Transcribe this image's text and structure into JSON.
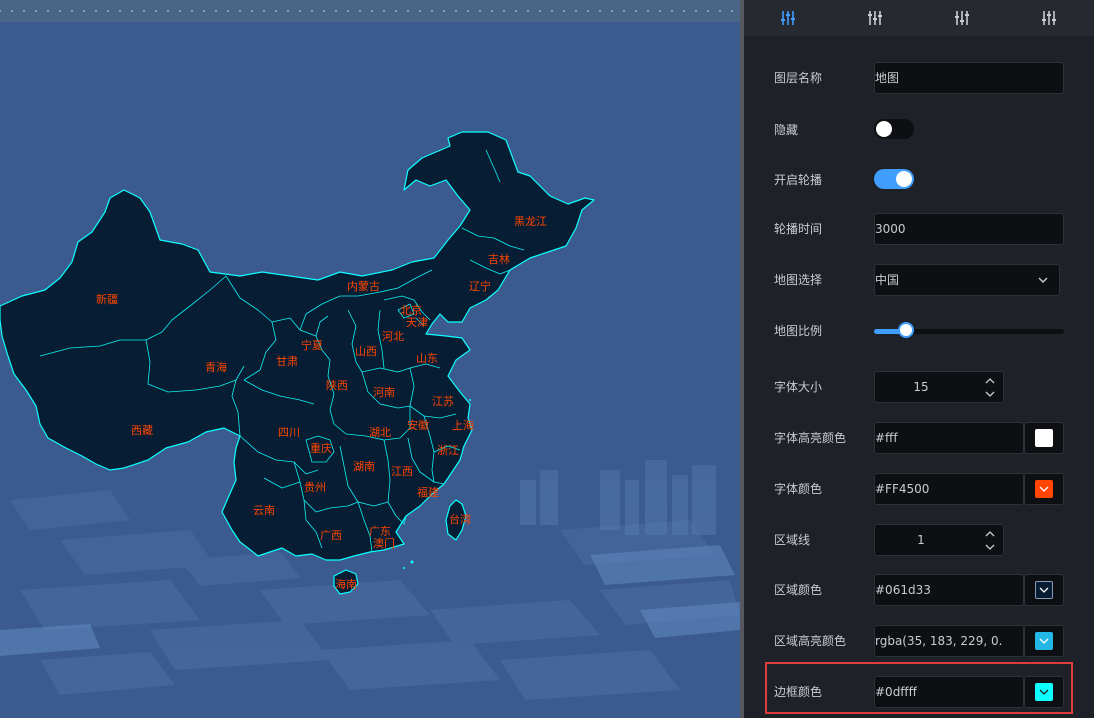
{
  "canvas": {
    "background": "#3b5b8f",
    "map": {
      "region_color": "#061d33",
      "border_color": "#0dffff",
      "label_color": "#FF4500",
      "provinces": [
        {
          "name": "新疆"
        },
        {
          "name": "西藏"
        },
        {
          "name": "青海"
        },
        {
          "name": "甘肃"
        },
        {
          "name": "内蒙古"
        },
        {
          "name": "黑龙江"
        },
        {
          "name": "吉林"
        },
        {
          "name": "辽宁"
        },
        {
          "name": "北京"
        },
        {
          "name": "天津"
        },
        {
          "name": "河北"
        },
        {
          "name": "山西"
        },
        {
          "name": "宁夏"
        },
        {
          "name": "陕西"
        },
        {
          "name": "山东"
        },
        {
          "name": "河南"
        },
        {
          "name": "江苏"
        },
        {
          "name": "安徽"
        },
        {
          "name": "上海"
        },
        {
          "name": "浙江"
        },
        {
          "name": "湖北"
        },
        {
          "name": "四川"
        },
        {
          "name": "重庆"
        },
        {
          "name": "湖南"
        },
        {
          "name": "江西"
        },
        {
          "name": "贵州"
        },
        {
          "name": "云南"
        },
        {
          "name": "福建"
        },
        {
          "name": "台湾"
        },
        {
          "name": "广西"
        },
        {
          "name": "广东"
        },
        {
          "name": "澳门"
        },
        {
          "name": "海南"
        }
      ]
    }
  },
  "panel": {
    "tabs": [
      {
        "icon": "sliders-icon",
        "active": true
      },
      {
        "icon": "sliders-icon",
        "active": false
      },
      {
        "icon": "sliders-icon",
        "active": false
      },
      {
        "icon": "sliders-icon",
        "active": false
      }
    ],
    "fields": {
      "layer_name": {
        "label": "图层名称",
        "value": "地图"
      },
      "hidden": {
        "label": "隐藏",
        "on": false
      },
      "carousel": {
        "label": "开启轮播",
        "on": true
      },
      "carousel_time": {
        "label": "轮播时间",
        "value": "3000"
      },
      "map_select": {
        "label": "地图选择",
        "value": "中国"
      },
      "map_scale": {
        "label": "地图比例",
        "fraction": 0.14
      },
      "font_size": {
        "label": "字体大小",
        "value": "15"
      },
      "font_highlight_color": {
        "label": "字体高亮颜色",
        "value": "#fff",
        "swatch": "#ffffff"
      },
      "font_color": {
        "label": "字体颜色",
        "value": "#FF4500",
        "swatch": "#FF4500"
      },
      "region_line": {
        "label": "区域线",
        "value": "1"
      },
      "region_color": {
        "label": "区域颜色",
        "value": "#061d33",
        "swatch": "#061d33"
      },
      "region_highlight_color": {
        "label": "区域高亮颜色",
        "value": "rgba(35, 183, 229, 0.",
        "swatch": "#23b7e5"
      },
      "border_color": {
        "label": "边框颜色",
        "value": "#0dffff",
        "swatch": "#0dffff"
      }
    },
    "accent": "#409eff",
    "highlight_outline": "#e03c3c"
  }
}
